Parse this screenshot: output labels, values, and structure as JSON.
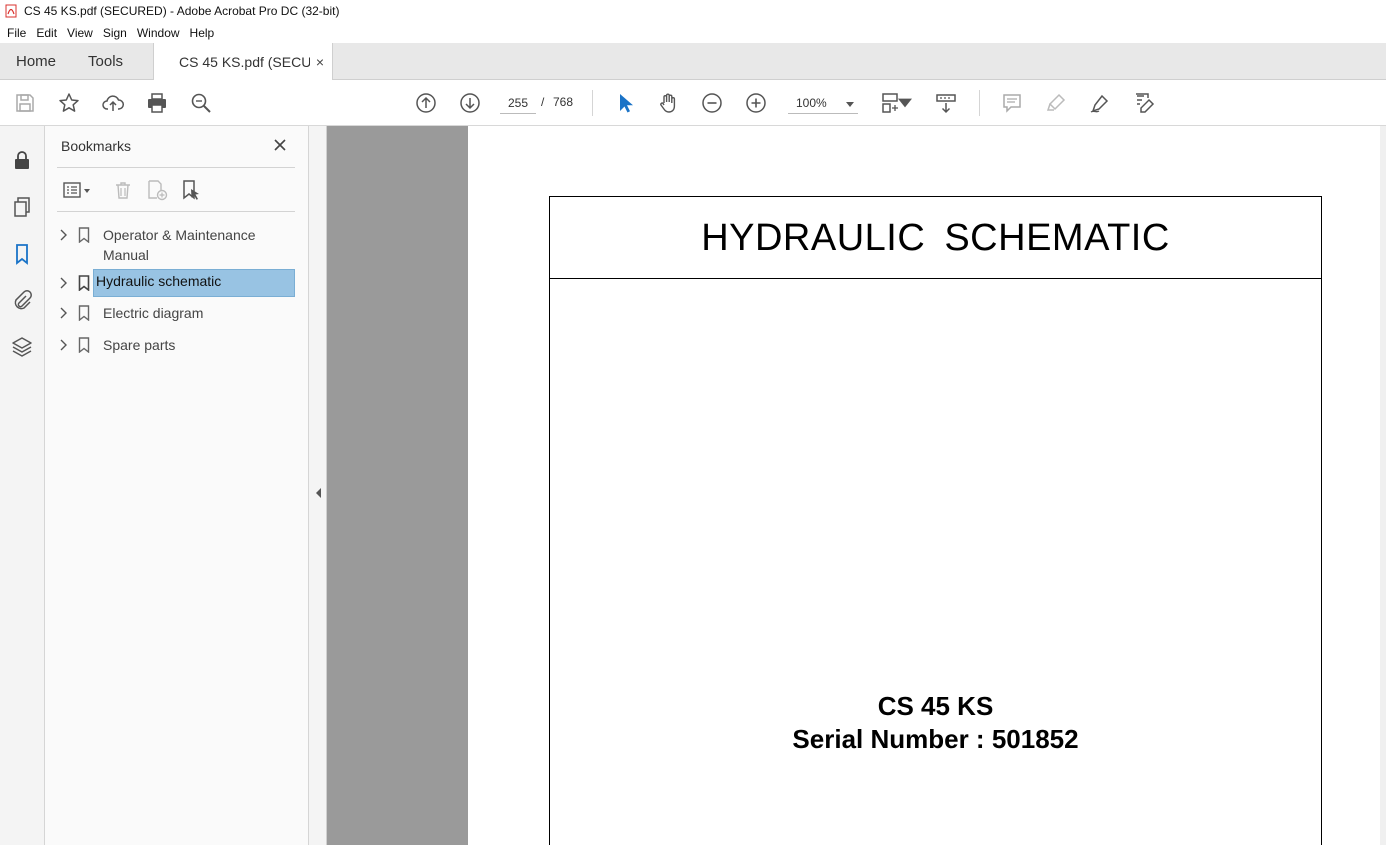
{
  "window": {
    "title": "CS 45 KS.pdf (SECURED) - Adobe Acrobat Pro DC (32-bit)"
  },
  "menu": [
    "File",
    "Edit",
    "View",
    "Sign",
    "Window",
    "Help"
  ],
  "tabs": {
    "home": "Home",
    "tools": "Tools",
    "document": "CS 45 KS.pdf (SECU...",
    "close": "×"
  },
  "toolbar": {
    "current_page": "255",
    "separator": "/",
    "total_pages": "768",
    "zoom": "100%",
    "icons": [
      "save-icon",
      "bookmark-star-icon",
      "upload-cloud-icon",
      "print-icon",
      "zoom-search-icon",
      "page-up-icon",
      "page-down-icon",
      "select-cursor-icon",
      "hand-icon",
      "zoom-out-icon",
      "zoom-in-icon",
      "fit-page-icon",
      "scroll-mode-icon",
      "comment-icon",
      "highlight-icon",
      "sign-pen-icon",
      "edit-document-icon"
    ]
  },
  "bookmarks": {
    "header": "Bookmarks",
    "items": [
      {
        "label": "Operator & Maintenance Manual",
        "selected": false
      },
      {
        "label": "Hydraulic schematic",
        "selected": true
      },
      {
        "label": "Electric diagram",
        "selected": false
      },
      {
        "label": "Spare parts",
        "selected": false
      }
    ]
  },
  "document": {
    "title": "HYDRAULIC  SCHEMATIC",
    "model": "CS 45 KS",
    "serial": "Serial Number : 501852"
  },
  "colors": {
    "accent": "#1a73c7",
    "selection": "#98c3e3",
    "pdf_red": "#d9302c"
  }
}
